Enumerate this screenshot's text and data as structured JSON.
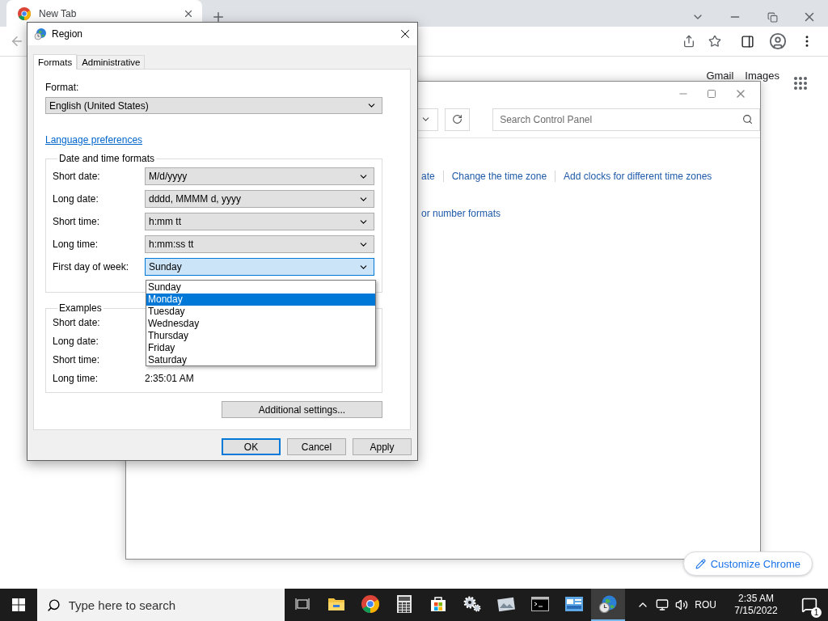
{
  "browser": {
    "tab": {
      "title": "New Tab"
    },
    "top_links": [
      "Gmail",
      "Images"
    ],
    "customize_button": "Customize Chrome"
  },
  "control_panel": {
    "search": {
      "placeholder": "Search Control Panel"
    },
    "link_rows": [
      {
        "links": [
          "ate",
          "Change the time zone",
          "Add clocks for different time zones"
        ]
      },
      {
        "links": [
          "or number formats"
        ]
      }
    ]
  },
  "region_dialog": {
    "title": "Region",
    "tabs": [
      {
        "label": "Formats",
        "selected": true
      },
      {
        "label": "Administrative",
        "selected": false
      }
    ],
    "format": {
      "label": "Format:",
      "value": "English (United States)"
    },
    "link": "Language preferences",
    "date_time_group": {
      "title": "Date and time formats",
      "rows": [
        {
          "label": "Short date:",
          "value": "M/d/yyyy",
          "focused": false
        },
        {
          "label": "Long date:",
          "value": "dddd, MMMM d, yyyy",
          "focused": false
        },
        {
          "label": "Short time:",
          "value": "h:mm tt",
          "focused": false
        },
        {
          "label": "Long time:",
          "value": "h:mm:ss tt",
          "focused": false
        },
        {
          "label": "First day of week:",
          "value": "Sunday",
          "focused": true
        }
      ]
    },
    "dropdown": {
      "options": [
        {
          "label": "Sunday",
          "selected": false
        },
        {
          "label": "Monday",
          "selected": true
        },
        {
          "label": "Tuesday",
          "selected": false
        },
        {
          "label": "Wednesday",
          "selected": false
        },
        {
          "label": "Thursday",
          "selected": false
        },
        {
          "label": "Friday",
          "selected": false
        },
        {
          "label": "Saturday",
          "selected": false
        }
      ]
    },
    "examples": {
      "title": "Examples",
      "rows": [
        {
          "label": "Short date:"
        },
        {
          "label": "Long date:"
        },
        {
          "label": "Short time:"
        },
        {
          "label": "Long time:",
          "value": "2:35:01 AM"
        }
      ]
    },
    "additional_button": "Additional settings...",
    "buttons": [
      {
        "label": "OK",
        "default": true
      },
      {
        "label": "Cancel",
        "default": false
      },
      {
        "label": "Apply",
        "default": false
      }
    ]
  },
  "taskbar": {
    "search_placeholder": "Type here to search",
    "apps": [
      {
        "kind": "task-view",
        "active": false
      },
      {
        "kind": "folder",
        "active": false
      },
      {
        "kind": "chrome",
        "active": false
      },
      {
        "kind": "calculator",
        "active": false
      },
      {
        "kind": "store",
        "active": false
      },
      {
        "kind": "settings",
        "active": false
      },
      {
        "kind": "photo",
        "active": false
      },
      {
        "kind": "terminal",
        "active": false
      },
      {
        "kind": "control-panel",
        "active": false
      },
      {
        "kind": "region",
        "active": true
      }
    ],
    "language": "ROU",
    "time": "2:35 AM",
    "date": "7/15/2022",
    "notification_count": "1"
  }
}
